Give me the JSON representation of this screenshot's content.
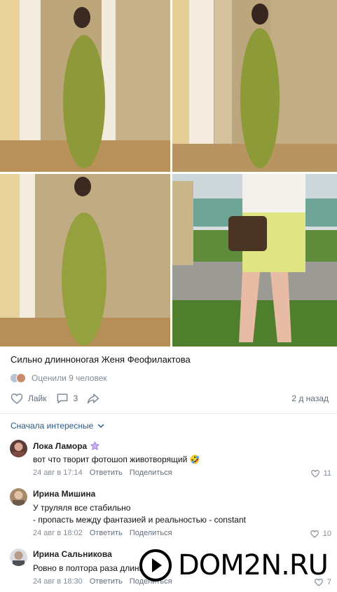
{
  "photos": [
    {
      "name": "photo-1"
    },
    {
      "name": "photo-2"
    },
    {
      "name": "photo-3"
    },
    {
      "name": "photo-4"
    }
  ],
  "post": {
    "text": "Сильно длинноногая Женя Феофилактова",
    "rated": "Оценили 9 человек",
    "like_label": "Лайк",
    "comments_count": "3",
    "time_ago": "2 д назад"
  },
  "comments_sort": "Сначала интересные",
  "comments": [
    {
      "author": "Лока Ламора",
      "lines": [
        "вот что творит фотошоп животворящий 🤣"
      ],
      "date": "24 авг в 17:14",
      "reply": "Ответить",
      "share": "Поделиться",
      "likes": "11"
    },
    {
      "author": "Ирина Мишина",
      "lines": [
        "У труляля все стабильно",
        "- пропасть между фантазией и реальностью - constant"
      ],
      "date": "24 авг в 18:02",
      "reply": "Ответить",
      "share": "Поделиться",
      "likes": "10"
    },
    {
      "author": "Ирина Сальникова",
      "lines": [
        "Ровно в полтора раза длинн :)"
      ],
      "date": "24 авг в 18:30",
      "reply": "Ответить",
      "share": "Поделиться",
      "likes": "7"
    }
  ],
  "watermark": {
    "text": "DOM2N.RU"
  },
  "colors": {
    "link": "#2a5885",
    "muted": "#818c99",
    "divider": "#e7e8ec"
  }
}
